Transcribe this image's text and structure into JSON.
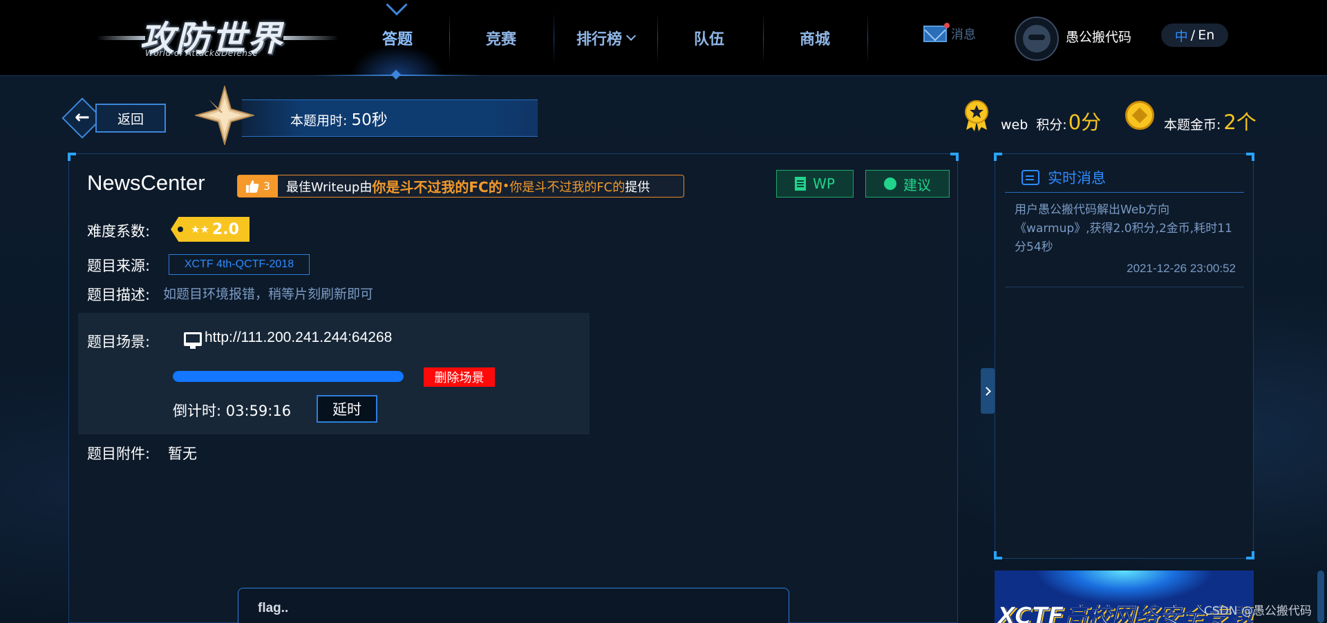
{
  "logo": {
    "cn": "攻防世界",
    "en": "World of Attack&Defense"
  },
  "nav": {
    "items": [
      {
        "label": "答题",
        "active": true
      },
      {
        "label": "竞赛",
        "active": false
      },
      {
        "label": "排行榜",
        "active": false,
        "has_dropdown": true
      },
      {
        "label": "队伍",
        "active": false
      },
      {
        "label": "商城",
        "active": false
      }
    ],
    "messages_label": "消息",
    "username": "愚公搬代码",
    "lang_zh": "中",
    "lang_sep": " / ",
    "lang_en": "En"
  },
  "header": {
    "back_label": "返回",
    "time_label": "本题用时:",
    "time_value": "50秒",
    "category": "web",
    "score_label": "积分:",
    "score_value": "0分",
    "coin_label": "本题金币:",
    "coin_value": "2个"
  },
  "task": {
    "title": "NewsCenter",
    "likes": "3",
    "writeup_prefix": "最佳Writeup由",
    "writeup_author": "你是斗不过我的FC的",
    "writeup_dot": " • ",
    "writeup_team": "你是斗不过我的FC的",
    "writeup_suffix": "提供",
    "wp_label": "WP",
    "suggest_label": "建议",
    "difficulty_label": "难度系数:",
    "difficulty_stars": "★★",
    "difficulty_value": "2.0",
    "source_label": "题目来源:",
    "source_value": "XCTF 4th-QCTF-2018",
    "desc_label": "题目描述:",
    "desc_value": "如题目环境报错，稍等片刻刷新即可",
    "scene_label": "题目场景:",
    "scene_url": "http://111.200.241.244:64268",
    "scene_progress": 1.0,
    "delete_label": "删除场景",
    "countdown_label": "倒计时:",
    "countdown_value": "03:59:16",
    "extend_label": "延时",
    "attach_label": "题目附件:",
    "attach_value": "暂无",
    "flag_placeholder": "flag.."
  },
  "feed": {
    "title": "实时消息",
    "message": "用户愚公搬代码解出Web方向《warmup》,获得2.0积分,2金币,耗时11分54秒",
    "time": "2021-12-26 23:00:52"
  },
  "banner": {
    "text": "XCTF高校网络安全专题挑战赛"
  },
  "watermark": "CSDN @愚公搬代码",
  "colors": {
    "accent_blue": "#2d8cff",
    "gold": "#f8c520",
    "orange": "#f59a2a",
    "green": "#22d38c",
    "danger": "#ff0a0a"
  }
}
